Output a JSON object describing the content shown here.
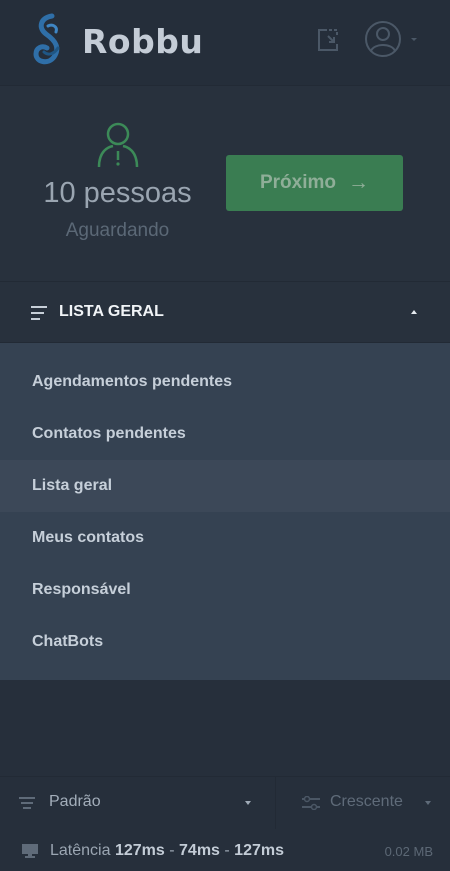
{
  "header": {
    "brand": "Robbu"
  },
  "queue": {
    "count": "10 pessoas",
    "status": "Aguardando",
    "next_label": "Próximo",
    "next_arrow": "→"
  },
  "section": {
    "title": "LISTA GERAL"
  },
  "menu": {
    "items": [
      {
        "label": "Agendamentos pendentes"
      },
      {
        "label": "Contatos pendentes"
      },
      {
        "label": "Lista geral",
        "active": true
      },
      {
        "label": "Meus contatos"
      },
      {
        "label": "Responsável"
      },
      {
        "label": "ChatBots"
      }
    ]
  },
  "footer": {
    "order": "Padrão",
    "direction": "Crescente",
    "latency_prefix": "Latência",
    "latency_1": "127ms",
    "latency_2": "74ms",
    "latency_3": "127ms",
    "separator": "-",
    "size": "0.02 MB"
  },
  "colors": {
    "background": "#262f3b",
    "menu_bg": "#354252",
    "menu_active": "#3c4858",
    "accent_green": "#3a7d52",
    "brand_blue": "#2f6fa8"
  }
}
